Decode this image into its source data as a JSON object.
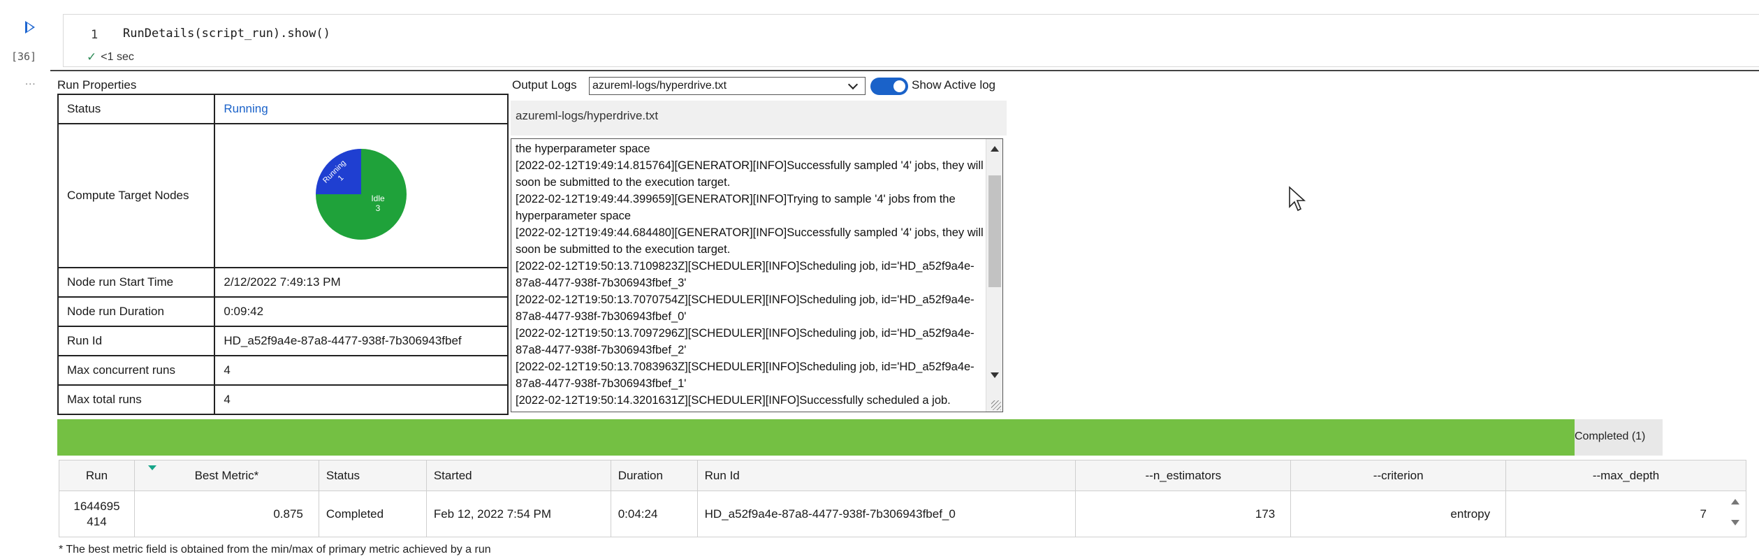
{
  "cell": {
    "exec_count": "[36]",
    "line_number": "1",
    "code": "RunDetails(script_run).show()",
    "status": "<1 sec",
    "output_prompt": "..."
  },
  "run_properties": {
    "title": "Run Properties",
    "rows": [
      {
        "key": "Status",
        "value": "Running"
      },
      {
        "key": "Compute Target Nodes",
        "value": ""
      },
      {
        "key": "Node run Start Time",
        "value": "2/12/2022 7:49:13 PM"
      },
      {
        "key": "Node run Duration",
        "value": "0:09:42"
      },
      {
        "key": "Run Id",
        "value": "HD_a52f9a4e-87a8-4477-938f-7b306943fbef"
      },
      {
        "key": "Max concurrent runs",
        "value": "4"
      },
      {
        "key": "Max total runs",
        "value": "4"
      }
    ],
    "nodes_pie": {
      "slices": [
        {
          "label": "Running",
          "count": "1",
          "value": 1,
          "color": "#1f3fd1"
        },
        {
          "label": "Idle",
          "count": "3",
          "value": 3,
          "color": "#1fa23a"
        }
      ]
    }
  },
  "output_logs": {
    "label": "Output Logs",
    "selected": "azureml-logs/hyperdrive.txt",
    "toggle_label": "Show Active log",
    "toggle_on": true,
    "path": "azureml-logs/hyperdrive.txt",
    "text": "the hyperparameter space\n[2022-02-12T19:49:14.815764][GENERATOR][INFO]Successfully sampled '4' jobs, they will soon be submitted to the execution target.\n[2022-02-12T19:49:44.399659][GENERATOR][INFO]Trying to sample '4' jobs from the hyperparameter space\n[2022-02-12T19:49:44.684480][GENERATOR][INFO]Successfully sampled '4' jobs, they will soon be submitted to the execution target.\n[2022-02-12T19:50:13.7109823Z][SCHEDULER][INFO]Scheduling job, id='HD_a52f9a4e-87a8-4477-938f-7b306943fbef_3'\n[2022-02-12T19:50:13.7070754Z][SCHEDULER][INFO]Scheduling job, id='HD_a52f9a4e-87a8-4477-938f-7b306943fbef_0'\n[2022-02-12T19:50:13.7097296Z][SCHEDULER][INFO]Scheduling job, id='HD_a52f9a4e-87a8-4477-938f-7b306943fbef_2'\n[2022-02-12T19:50:13.7083963Z][SCHEDULER][INFO]Scheduling job, id='HD_a52f9a4e-87a8-4477-938f-7b306943fbef_1'\n[2022-02-12T19:50:14.3201631Z][SCHEDULER][INFO]Successfully scheduled a job."
  },
  "progress": {
    "label": "Completed (1)",
    "fraction": 0.945,
    "color": "#74c043"
  },
  "runs_table": {
    "columns": [
      "Run",
      "Best Metric*",
      "Status",
      "Started",
      "Duration",
      "Run Id",
      "--n_estimators",
      "--criterion",
      "--max_depth"
    ],
    "rows": [
      {
        "run": "1644695\n414",
        "best_metric": "0.875",
        "status": "Completed",
        "started": "Feb 12, 2022 7:54 PM",
        "duration": "0:04:24",
        "run_id": "HD_a52f9a4e-87a8-4477-938f-7b306943fbef_0",
        "n_estimators": "173",
        "criterion": "entropy",
        "max_depth": "7"
      }
    ]
  },
  "footnote": "* The best metric field is obtained from the min/max of primary metric achieved by a run"
}
